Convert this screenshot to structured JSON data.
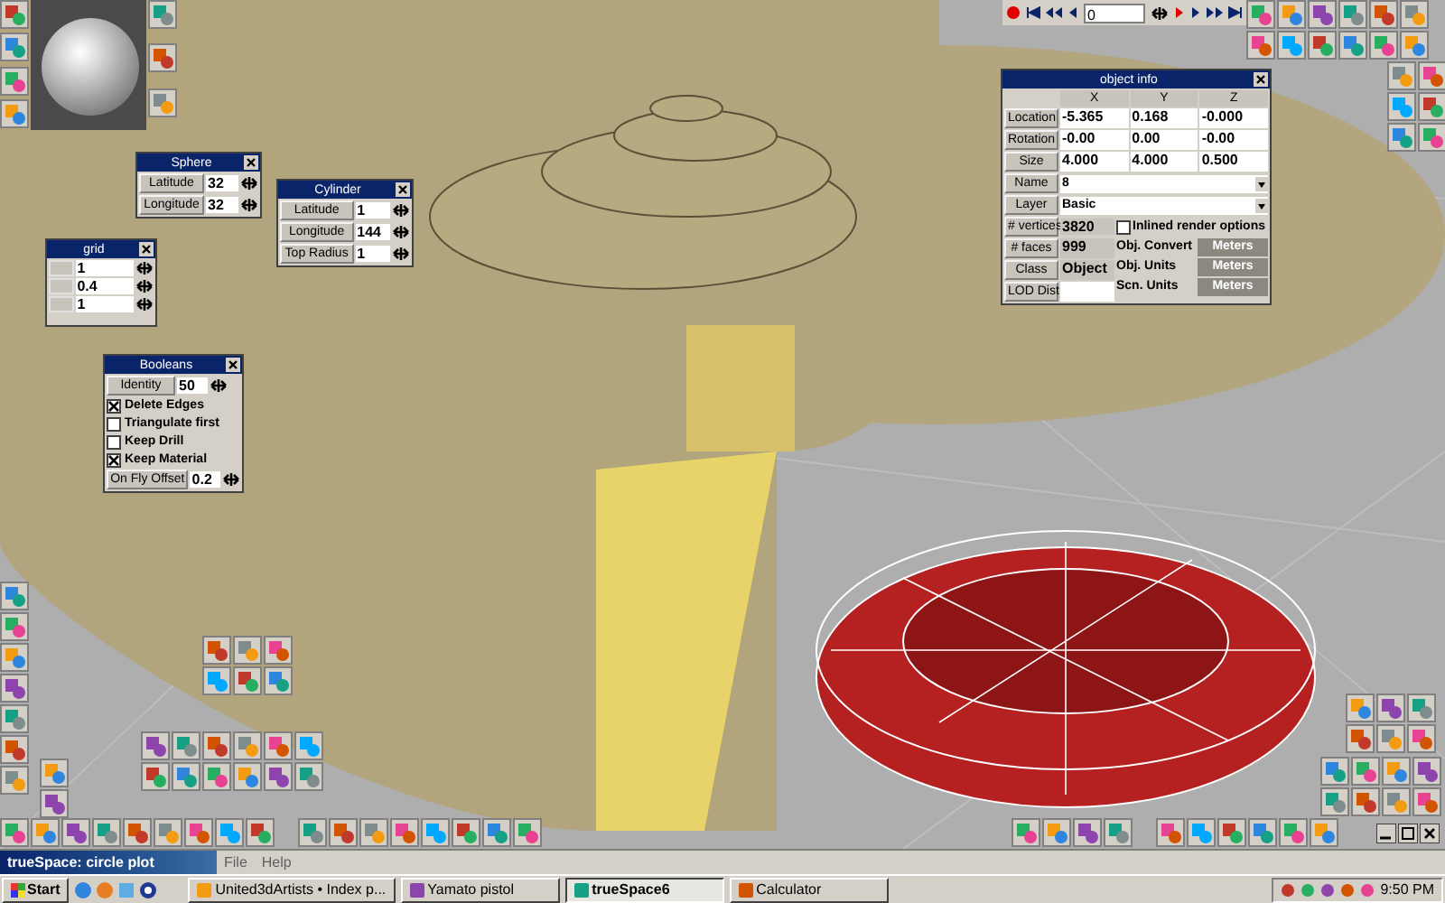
{
  "playback": {
    "frame": "0"
  },
  "sphere_panel": {
    "title": "Sphere",
    "fields": [
      {
        "label": "Latitude",
        "value": "32"
      },
      {
        "label": "Longitude",
        "value": "32"
      }
    ]
  },
  "cylinder_panel": {
    "title": "Cylinder",
    "fields": [
      {
        "label": "Latitude",
        "value": "1"
      },
      {
        "label": "Longitude",
        "value": "144"
      },
      {
        "label": "Top Radius",
        "value": "1"
      }
    ]
  },
  "grid_panel": {
    "title": "grid",
    "values": [
      "1",
      "0.4",
      "1"
    ]
  },
  "booleans_panel": {
    "title": "Booleans",
    "identity": {
      "label": "Identity",
      "value": "50"
    },
    "options": [
      {
        "label": "Delete Edges",
        "checked": true
      },
      {
        "label": "Triangulate first",
        "checked": false
      },
      {
        "label": "Keep Drill",
        "checked": false
      },
      {
        "label": "Keep Material",
        "checked": true
      }
    ],
    "offset": {
      "label": "On Fly Offset",
      "value": "0.2"
    }
  },
  "object_info": {
    "title": "object info",
    "columns": [
      "X",
      "Y",
      "Z"
    ],
    "rows": [
      {
        "label": "Location",
        "values": [
          "-5.365",
          "0.168",
          "-0.000"
        ]
      },
      {
        "label": "Rotation",
        "values": [
          "-0.00",
          "0.00",
          "-0.00"
        ]
      },
      {
        "label": "Size",
        "values": [
          "4.000",
          "4.000",
          "0.500"
        ]
      }
    ],
    "name": {
      "label": "Name",
      "value": "8"
    },
    "layer": {
      "label": "Layer",
      "value": "Basic"
    },
    "vertices": {
      "label": "# vertices",
      "value": "3820"
    },
    "inlined": {
      "label": "Inlined render options",
      "checked": false
    },
    "faces": {
      "label": "# faces",
      "value": "999"
    },
    "class": {
      "label": "Class",
      "value": "Object"
    },
    "lod": {
      "label": "LOD Dist"
    },
    "unit_buttons": [
      {
        "label": "Obj. Convert",
        "unit": "Meters",
        "disabled": true
      },
      {
        "label": "Obj. Units",
        "unit": "Meters",
        "disabled": true
      },
      {
        "label": "Scn. Units",
        "unit": "Meters",
        "disabled": true
      }
    ]
  },
  "app_bar": {
    "title": "trueSpace: circle plot",
    "menu": [
      "File",
      "Help"
    ]
  },
  "taskbar": {
    "start": "Start",
    "tasks": [
      {
        "label": "United3dArtists • Index p...",
        "selected": false
      },
      {
        "label": "Yamato pistol",
        "selected": false
      },
      {
        "label": "trueSpace6",
        "selected": true
      },
      {
        "label": "Calculator",
        "selected": false
      }
    ],
    "clock": "9:50 PM"
  }
}
